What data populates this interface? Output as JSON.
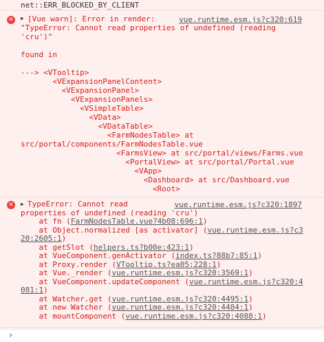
{
  "net_error": "net::ERR_BLOCKED_BY_CLIENT",
  "entry1": {
    "icon": "error-icon",
    "source": "vue.runtime.esm.js?c320:619",
    "lines": [
      "[Vue warn]: Error in render:",
      "\"TypeError: Cannot read properties of undefined (reading",
      "'cru')\"",
      "",
      "found in",
      "",
      "---> <VTooltip>",
      "       <VExpansionPanelContent>",
      "         <VExpansionPanel>",
      "           <VExpansionPanels>",
      "             <VSimpleTable>",
      "               <VData>",
      "                 <VDataTable>",
      "                   <FarmNodesTable> at",
      "src/portal/components/FarmNodesTable.vue",
      "                     <FarmsView> at src/portal/views/Farms.vue",
      "                       <PortalView> at src/portal/Portal.vue",
      "                         <VApp>",
      "                           <Dashboard> at src/Dashboard.vue",
      "                             <Root>"
    ]
  },
  "entry2": {
    "icon": "error-icon",
    "source": "vue.runtime.esm.js?c320:1897",
    "lines": [
      {
        "pre": "TypeError: Cannot read",
        "link": "",
        "post": ""
      },
      {
        "pre": "properties of undefined (reading 'cru')",
        "link": "",
        "post": ""
      },
      {
        "pre": "    at fn (",
        "link": "FarmNodesTable.vue?4b08:696:1",
        "post": ")"
      },
      {
        "pre": "    at Object.normalized [as activator] (",
        "link": "vue.runtime.esm.js?c3",
        "post": ""
      },
      {
        "pre": "",
        "link": "20:2605:1",
        "post": ")"
      },
      {
        "pre": "    at getSlot (",
        "link": "helpers.ts?b00e:423:1",
        "post": ")"
      },
      {
        "pre": "    at VueComponent.genActivator (",
        "link": "index.ts?88b7:85:1",
        "post": ")"
      },
      {
        "pre": "    at Proxy.render (",
        "link": "VTooltip.ts?ea05:228:1",
        "post": ")"
      },
      {
        "pre": "    at Vue._render (",
        "link": "vue.runtime.esm.js?c320:3569:1",
        "post": ")"
      },
      {
        "pre": "    at VueComponent.updateComponent (",
        "link": "vue.runtime.esm.js?c320:4",
        "post": ""
      },
      {
        "pre": "",
        "link": "081:1",
        "post": ")"
      },
      {
        "pre": "    at Watcher.get (",
        "link": "vue.runtime.esm.js?c320:4495:1",
        "post": ")"
      },
      {
        "pre": "    at new Watcher (",
        "link": "vue.runtime.esm.js?c320:4484:1",
        "post": ")"
      },
      {
        "pre": "    at mountComponent (",
        "link": "vue.runtime.esm.js?c320:4088:1",
        "post": ")"
      }
    ]
  },
  "prompt": {
    "icon": "chevron-right-icon",
    "chevron": "›",
    "value": ""
  },
  "colors": {
    "error_text": "#d0201c",
    "error_bg": "#fff0f0",
    "error_icon": "#e8413a",
    "prompt_chevron": "#1a73e8"
  }
}
